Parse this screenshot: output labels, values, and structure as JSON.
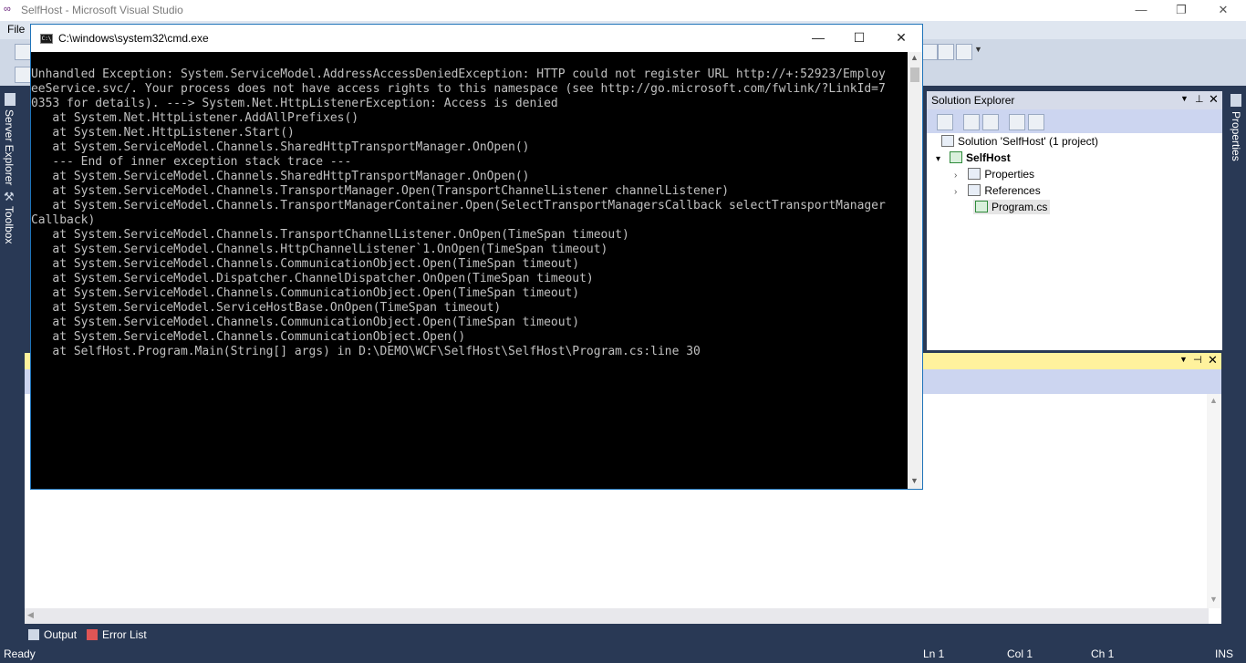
{
  "vs": {
    "title": "SelfHost - Microsoft Visual Studio",
    "menu_file": "File",
    "left_strip": {
      "server_explorer": "Server Explorer",
      "toolbox": "Toolbox"
    },
    "right_strip": {
      "properties": "Properties"
    }
  },
  "solution_explorer": {
    "title": "Solution Explorer",
    "solution": "Solution 'SelfHost' (1 project)",
    "project": "SelfHost",
    "items": [
      "Properties",
      "References",
      "Program.cs"
    ]
  },
  "bottom_tabs": [
    "Output",
    "Error List"
  ],
  "status": {
    "ready": "Ready",
    "ln": "Ln 1",
    "col": "Col 1",
    "ch": "Ch 1",
    "ins": "INS"
  },
  "cmd": {
    "title": "C:\\windows\\system32\\cmd.exe",
    "icon_label": "C:\\",
    "lines": [
      "Unhandled Exception: System.ServiceModel.AddressAccessDeniedException: HTTP could not register URL http://+:52923/Employ",
      "eeService.svc/. Your process does not have access rights to this namespace (see http://go.microsoft.com/fwlink/?LinkId=7",
      "0353 for details). ---> System.Net.HttpListenerException: Access is denied",
      "   at System.Net.HttpListener.AddAllPrefixes()",
      "   at System.Net.HttpListener.Start()",
      "   at System.ServiceModel.Channels.SharedHttpTransportManager.OnOpen()",
      "   --- End of inner exception stack trace ---",
      "   at System.ServiceModel.Channels.SharedHttpTransportManager.OnOpen()",
      "   at System.ServiceModel.Channels.TransportManager.Open(TransportChannelListener channelListener)",
      "   at System.ServiceModel.Channels.TransportManagerContainer.Open(SelectTransportManagersCallback selectTransportManager",
      "Callback)",
      "   at System.ServiceModel.Channels.TransportChannelListener.OnOpen(TimeSpan timeout)",
      "   at System.ServiceModel.Channels.HttpChannelListener`1.OnOpen(TimeSpan timeout)",
      "   at System.ServiceModel.Channels.CommunicationObject.Open(TimeSpan timeout)",
      "   at System.ServiceModel.Dispatcher.ChannelDispatcher.OnOpen(TimeSpan timeout)",
      "   at System.ServiceModel.Channels.CommunicationObject.Open(TimeSpan timeout)",
      "   at System.ServiceModel.ServiceHostBase.OnOpen(TimeSpan timeout)",
      "   at System.ServiceModel.Channels.CommunicationObject.Open(TimeSpan timeout)",
      "   at System.ServiceModel.Channels.CommunicationObject.Open()",
      "   at SelfHost.Program.Main(String[] args) in D:\\DEMO\\WCF\\SelfHost\\SelfHost\\Program.cs:line 30"
    ]
  },
  "colors": {
    "vs_frame": "#293955",
    "output_header": "#fff29d",
    "cmd_text": "#c0c0c0"
  }
}
